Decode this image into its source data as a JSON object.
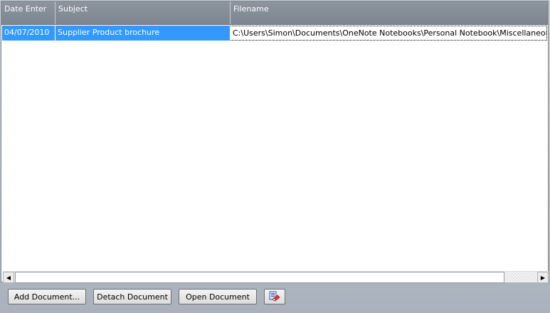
{
  "grid": {
    "columns": [
      "Date Enter",
      "Subject",
      "Filename"
    ],
    "rows": [
      {
        "date": "04/07/2010",
        "subject": "Supplier Product brochure",
        "filename": "C:\\Users\\Simon\\Documents\\OneNote Notebooks\\Personal Notebook\\Miscellaneous.one"
      }
    ]
  },
  "scrollbar": {
    "left_arrow": "◀",
    "right_arrow": "▶"
  },
  "toolbar": {
    "add_label": "Add Document...",
    "detach_label": "Detach Document",
    "open_label": "Open Document",
    "extra_icon": "documents-eraser-icon"
  },
  "colors": {
    "selection": "#3399ff",
    "header": "#858d98",
    "background": "#b3bac4"
  }
}
